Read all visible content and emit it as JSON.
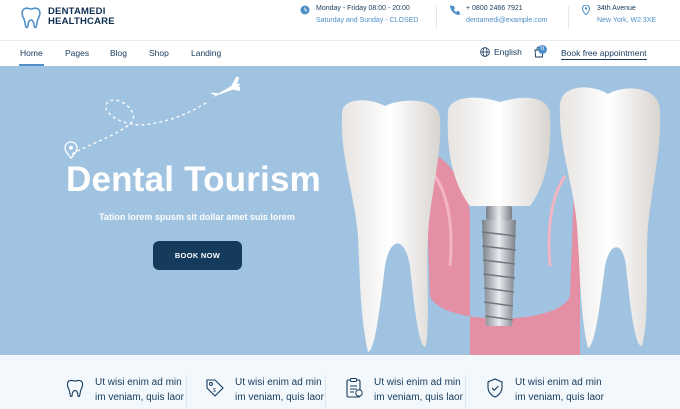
{
  "brand": {
    "line1": "DENTAMEDI",
    "line2": "HEALTHCARE"
  },
  "topbar": {
    "hours": {
      "icon": "clock-icon",
      "line1": "Monday - Friday 08:00 - 20:00",
      "line2": "Saturday and Sunday - CLOSED"
    },
    "contact": {
      "icon": "phone-icon",
      "line1": "+ 0800 2466 7921",
      "line2": "dentamedi@example.com"
    },
    "address": {
      "icon": "location-pin-icon",
      "line1": "34th Avenue",
      "line2": "New York, W2 3XE"
    }
  },
  "nav": {
    "items": [
      {
        "label": "Home",
        "active": true
      },
      {
        "label": "Pages"
      },
      {
        "label": "Blog"
      },
      {
        "label": "Shop"
      },
      {
        "label": "Landing"
      }
    ],
    "language": "English",
    "cart_count": "0",
    "cta": "Book free appointment"
  },
  "hero": {
    "title": "Dental Tourism",
    "subtitle": "Tation lorem spusm sit dollar amet suis lorem",
    "button": "BOOK NOW"
  },
  "features": [
    {
      "icon": "tooth-icon",
      "line1": "Ut wisi enim ad min",
      "line2": "im veniam, quis laor"
    },
    {
      "icon": "price-tag-icon",
      "line1": "Ut wisi enim ad min",
      "line2": "im veniam, quis laor"
    },
    {
      "icon": "clipboard-icon",
      "line1": "Ut wisi enim ad min",
      "line2": "im veniam, quis laor"
    },
    {
      "icon": "shield-icon",
      "line1": "Ut wisi enim ad min",
      "line2": "im veniam, quis laor"
    }
  ],
  "colors": {
    "accent": "#4f8fc7",
    "navy": "#143a5c",
    "hero_bg": "#9fc3e1",
    "gum": "#e58fa4"
  }
}
